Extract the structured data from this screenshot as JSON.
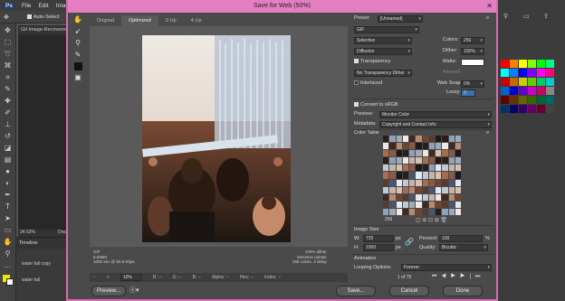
{
  "photoshop": {
    "menu": [
      "Ps",
      "File",
      "Edit",
      "Image"
    ],
    "auto_select_label": "Auto-Select",
    "doc_tab": "Gif Image-Recovered",
    "zoom": "34.52%",
    "doc_label": "Doc",
    "timeline_title": "Timeline",
    "layer1": "water fall copy",
    "layer2": "water fall"
  },
  "dialog": {
    "title": "Save for Web (50%)",
    "close": "✕",
    "tabs": [
      "Original",
      "Optimized",
      "2-Up",
      "4-Up"
    ],
    "info_left": [
      "GIF",
      "8.598M",
      "1000 sec @ 56.6 Kbps"
    ],
    "info_right": [
      "100% dither",
      "Selective palette",
      "256 colors, 3 delay"
    ],
    "zoom_value": "10%",
    "status_items": [
      "R: --",
      "G: --",
      "B: --",
      "Alpha: --",
      "Hex: --",
      "Index: --"
    ],
    "preview_btn": "Preview...",
    "save_btn": "Save...",
    "cancel_btn": "Cancel",
    "done_btn": "Done"
  },
  "settings": {
    "preset_label": "Preset:",
    "preset_value": "[Unnamed]",
    "format": "GIF",
    "reduction": "Selective",
    "dither_algo": "Diffusion",
    "transparency_label": "Transparency",
    "transparency_dither": "No Transparency Dither",
    "interlaced_label": "Interlaced",
    "colors_label": "Colors:",
    "colors_value": "256",
    "dither_label": "Dither:",
    "dither_value": "100%",
    "matte_label": "Matte:",
    "amount_label": "Amount:",
    "websnap_label": "Web Snap:",
    "websnap_value": "0%",
    "lossy_label": "Lossy:",
    "lossy_value": "3",
    "convert_label": "Convert to sRGB",
    "preview_label": "Preview:",
    "preview_value": "Monitor Color",
    "metadata_label": "Metadata:",
    "metadata_value": "Copyright and Contact Info",
    "color_table_label": "Color Table",
    "color_count": "256",
    "image_size_label": "Image Size",
    "w_label": "W:",
    "w_value": "720",
    "h_label": "H:",
    "h_value": "1000",
    "px": "px",
    "percent_label": "Percent:",
    "percent_value": "100",
    "pct": "%",
    "quality_label": "Quality:",
    "quality_value": "Bicubic",
    "animation_label": "Animation",
    "looping_label": "Looping Options:",
    "looping_value": "Forever",
    "frame_counter": "1 of 75"
  },
  "colors": {
    "accent": "#e37fc1",
    "dialog_bg": "#4a4a4a"
  }
}
